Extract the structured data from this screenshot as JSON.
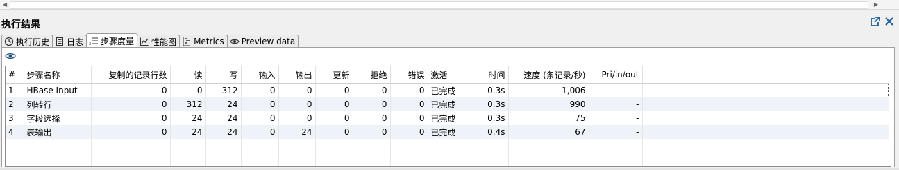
{
  "panel": {
    "title": "执行结果"
  },
  "tabs": [
    {
      "label": "执行历史",
      "icon": "history-icon",
      "active": false
    },
    {
      "label": "日志",
      "icon": "log-icon",
      "active": false
    },
    {
      "label": "步骤度量",
      "icon": "metrics-list-icon",
      "active": true
    },
    {
      "label": "性能图",
      "icon": "chart-icon",
      "active": false
    },
    {
      "label": "Metrics",
      "icon": "metrics-icon",
      "active": false
    },
    {
      "label": "Preview data",
      "icon": "eye-icon",
      "active": false
    }
  ],
  "table": {
    "columns": [
      "#",
      "步骤名称",
      "复制的记录行数",
      "读",
      "写",
      "输入",
      "输出",
      "更新",
      "拒绝",
      "错误",
      "激活",
      "时间",
      "速度 (条记录/秒)",
      "Pri/in/out"
    ],
    "rows": [
      [
        "1",
        "HBase Input",
        "0",
        "0",
        "312",
        "0",
        "0",
        "0",
        "0",
        "0",
        "已完成",
        "0.3s",
        "1,006",
        "-"
      ],
      [
        "2",
        "列转行",
        "0",
        "312",
        "24",
        "0",
        "0",
        "0",
        "0",
        "0",
        "已完成",
        "0.3s",
        "990",
        "-"
      ],
      [
        "3",
        "字段选择",
        "0",
        "24",
        "24",
        "0",
        "0",
        "0",
        "0",
        "0",
        "已完成",
        "0.3s",
        "75",
        "-"
      ],
      [
        "4",
        "表输出",
        "0",
        "24",
        "24",
        "0",
        "24",
        "0",
        "0",
        "0",
        "已完成",
        "0.4s",
        "67",
        "-"
      ]
    ]
  }
}
